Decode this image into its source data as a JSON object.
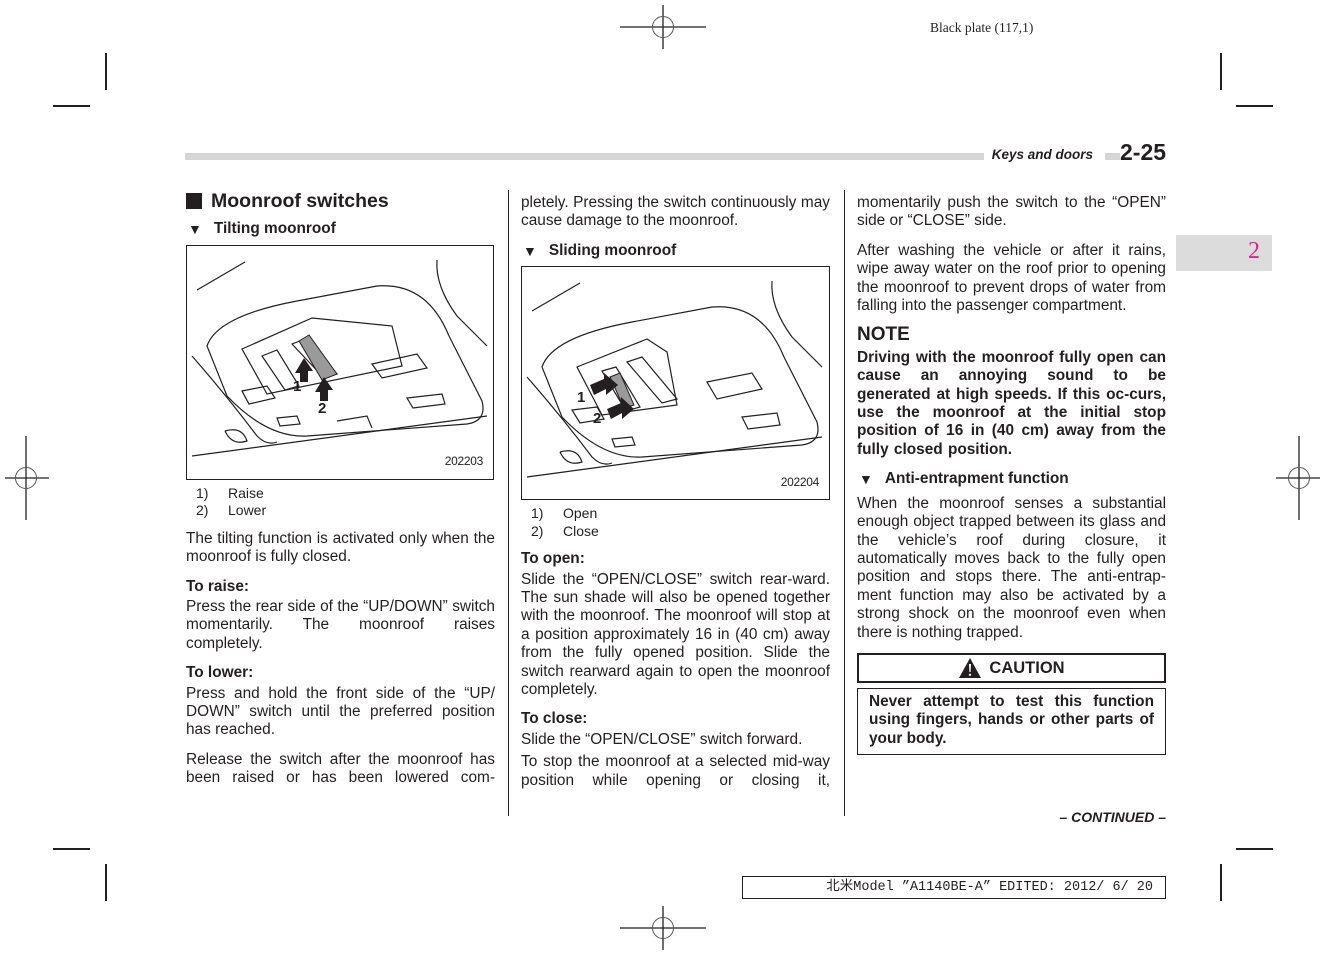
{
  "plate_label": "Black plate (117,1)",
  "header": {
    "section": "Keys and doors",
    "page_number": "2-25"
  },
  "chapter_tab": "2",
  "column1": {
    "title": "Moonroof switches",
    "subsection": "Tilting moonroof",
    "figure": {
      "code": "202203",
      "callouts": [
        "1",
        "2"
      ],
      "icon": "moonroof-switch-illustration"
    },
    "legend": [
      {
        "num": "1)",
        "label": "Raise"
      },
      {
        "num": "2)",
        "label": "Lower"
      }
    ],
    "para_tilt": "The tilting function is activated only when the moonroof is fully closed.",
    "raise_heading": "To raise:",
    "raise_text": "Press the rear side of the “UP/DOWN” switch momentarily. The moonroof raises completely.",
    "lower_heading": "To lower:",
    "lower_text": "Press and hold the front side of the “UP/ DOWN” switch until the preferred position has reached.",
    "release_text": "Release the switch after the moonroof has been raised or has been lowered com-"
  },
  "column2": {
    "continued_text": "pletely. Pressing the switch continuously may cause damage to the moonroof.",
    "subsection": "Sliding moonroof",
    "figure": {
      "code": "202204",
      "callouts": [
        "1",
        "2"
      ],
      "icon": "moonroof-switch-illustration"
    },
    "legend": [
      {
        "num": "1)",
        "label": "Open"
      },
      {
        "num": "2)",
        "label": "Close"
      }
    ],
    "open_heading": "To open:",
    "open_text": "Slide the “OPEN/CLOSE” switch rear-ward. The sun shade will also be opened together with the moonroof. The moonroof will stop at a position approximately 16 in (40 cm) away from the fully opened position. Slide the switch rearward again to open the moonroof completely.",
    "close_heading": "To close:",
    "close_text": "Slide the “OPEN/CLOSE” switch forward.",
    "stop_text": "To stop the moonroof at a selected mid-way position while opening or closing it,"
  },
  "column3": {
    "stop_cont": "momentarily push the switch to the “OPEN” side or “CLOSE” side.",
    "washing_text": "After washing the vehicle or after it rains, wipe away water on the roof prior to opening the moonroof to prevent drops of water from falling into the passenger compartment.",
    "note_title": "NOTE",
    "note_text": "Driving with the moonroof fully open can cause an annoying sound to be generated at high speeds. If this oc-curs, use the moonroof at the initial stop position of 16 in (40 cm) away from the fully closed position.",
    "subsection": "Anti-entrapment function",
    "anti_text": "When the moonroof senses a substantial enough object trapped between its glass and the vehicle’s roof during closure, it automatically moves back to the fully open position and stops there. The anti-entrap-ment function may also be activated by a strong shock on the moonroof even when there is nothing trapped.",
    "caution_title": "CAUTION",
    "caution_text": "Never attempt to test this function using fingers, hands or other parts of your body."
  },
  "continued_label": "– CONTINUED –",
  "footer_edited": "北米Model ”A1140BE-A” EDITED: 2012/ 6/ 20",
  "colors": {
    "text": "#231f20",
    "header_bar": "#d6d6d6",
    "chapter_tab_bg": "#dcdcdc",
    "chapter_tab_text": "#e0218a"
  }
}
